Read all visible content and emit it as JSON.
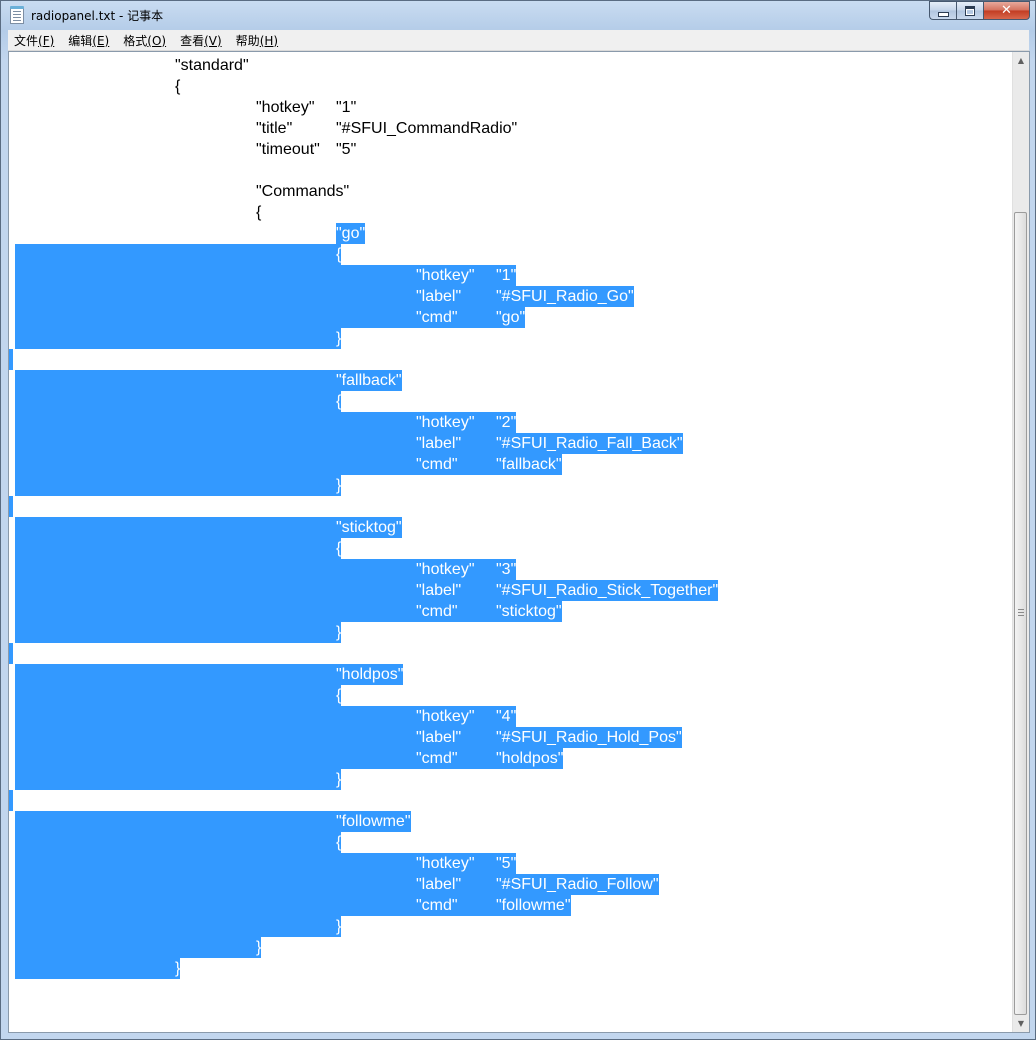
{
  "window": {
    "title": "radiopanel.txt - 记事本",
    "controls": {
      "minimize": "minimize-icon",
      "maximize": "maximize-icon",
      "close": "✕"
    }
  },
  "menu": [
    {
      "label": "文件",
      "accel": "(F)"
    },
    {
      "label": "编辑",
      "accel": "(E)"
    },
    {
      "label": "格式",
      "accel": "(O)"
    },
    {
      "label": "查看",
      "accel": "(V)"
    },
    {
      "label": "帮助",
      "accel": "(H)"
    }
  ],
  "colors": {
    "selection": "#3399ff",
    "selected_text": "#ffffff",
    "text": "#000000"
  },
  "document": {
    "lines": [
      {
        "tokens": [
          "\"standard\""
        ]
      },
      {
        "tokens": [
          "{"
        ]
      },
      {
        "tokens": [
          "\"hotkey\"",
          "\"1\""
        ]
      },
      {
        "tokens": [
          "\"title\"",
          "\"#SFUI_CommandRadio\""
        ]
      },
      {
        "tokens": [
          "\"timeout\"",
          "\"5\""
        ]
      },
      {
        "tokens": []
      },
      {
        "tokens": [
          "\"Commands\""
        ]
      },
      {
        "tokens": [
          "{"
        ]
      },
      {
        "tokens": [
          "\"go\""
        ]
      },
      {
        "tokens": [
          "{"
        ]
      },
      {
        "tokens": [
          "\"hotkey\"",
          "\"1\""
        ]
      },
      {
        "tokens": [
          "\"label\"",
          "\"#SFUI_Radio_Go\""
        ]
      },
      {
        "tokens": [
          "\"cmd\"",
          "\"go\""
        ]
      },
      {
        "tokens": [
          "}"
        ]
      },
      {
        "tokens": []
      },
      {
        "tokens": [
          "\"fallback\""
        ]
      },
      {
        "tokens": [
          "{"
        ]
      },
      {
        "tokens": [
          "\"hotkey\"",
          "\"2\""
        ]
      },
      {
        "tokens": [
          "\"label\"",
          "\"#SFUI_Radio_Fall_Back\""
        ]
      },
      {
        "tokens": [
          "\"cmd\"",
          "\"fallback\""
        ]
      },
      {
        "tokens": [
          "}"
        ]
      },
      {
        "tokens": []
      },
      {
        "tokens": [
          "\"sticktog\""
        ]
      },
      {
        "tokens": [
          "{"
        ]
      },
      {
        "tokens": [
          "\"hotkey\"",
          "\"3\""
        ]
      },
      {
        "tokens": [
          "\"label\"",
          "\"#SFUI_Radio_Stick_Together\""
        ]
      },
      {
        "tokens": [
          "\"cmd\"",
          "\"sticktog\""
        ]
      },
      {
        "tokens": [
          "}"
        ]
      },
      {
        "tokens": []
      },
      {
        "tokens": [
          "\"holdpos\""
        ]
      },
      {
        "tokens": [
          "{"
        ]
      },
      {
        "tokens": [
          "\"hotkey\"",
          "\"4\""
        ]
      },
      {
        "tokens": [
          "\"label\"",
          "\"#SFUI_Radio_Hold_Pos\""
        ]
      },
      {
        "tokens": [
          "\"cmd\"",
          "\"holdpos\""
        ]
      },
      {
        "tokens": [
          "}"
        ]
      },
      {
        "tokens": []
      },
      {
        "tokens": [
          "\"followme\""
        ]
      },
      {
        "tokens": [
          "{"
        ]
      },
      {
        "tokens": [
          "\"hotkey\"",
          "\"5\""
        ]
      },
      {
        "tokens": [
          "\"label\"",
          "\"#SFUI_Radio_Follow\""
        ]
      },
      {
        "tokens": [
          "\"cmd\"",
          "\"followme\""
        ]
      },
      {
        "tokens": [
          "}"
        ]
      },
      {
        "tokens": [
          "}"
        ]
      },
      {
        "tokens": [
          "}"
        ]
      }
    ]
  }
}
